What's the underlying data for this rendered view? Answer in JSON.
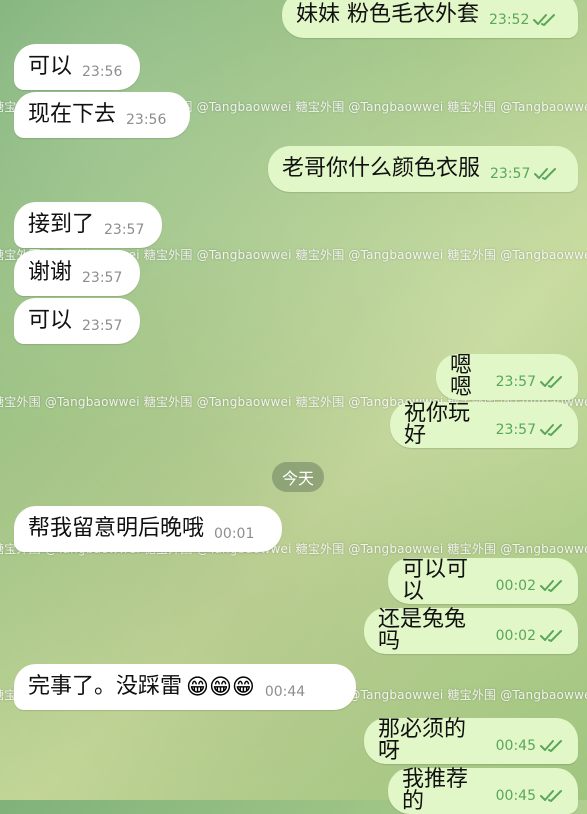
{
  "watermark": "糖宝外围 @Tangbaowwei  糖宝外围 @Tangbaowwei  糖宝外围 @Tangbaowwei  糖宝外围 @Tangbaowwei",
  "day_divider": "今天",
  "messages": [
    {
      "text": "妹妹 粉色毛衣外套",
      "time": "23:52",
      "side": "out",
      "read": true
    },
    {
      "text": "可以",
      "time": "23:56",
      "side": "in"
    },
    {
      "text": "现在下去",
      "time": "23:56",
      "side": "in"
    },
    {
      "text": "老哥你什么颜色衣服",
      "time": "23:57",
      "side": "out",
      "read": true
    },
    {
      "text": "接到了",
      "time": "23:57",
      "side": "in"
    },
    {
      "text": "谢谢",
      "time": "23:57",
      "side": "in"
    },
    {
      "text": "可以",
      "time": "23:57",
      "side": "in"
    },
    {
      "text": "嗯嗯",
      "time": "23:57",
      "side": "out",
      "read": true
    },
    {
      "text": "祝你玩好",
      "time": "23:57",
      "side": "out",
      "read": true
    },
    {
      "text": "帮我留意明后晚哦",
      "time": "00:01",
      "side": "in"
    },
    {
      "text": "可以可以",
      "time": "00:02",
      "side": "out",
      "read": true
    },
    {
      "text": "还是兔兔吗",
      "time": "00:02",
      "side": "out",
      "read": true
    },
    {
      "text": "完事了。没踩雷",
      "time": "00:44",
      "side": "in",
      "emoji": "😁😁😁"
    },
    {
      "text": "那必须的呀",
      "time": "00:45",
      "side": "out",
      "read": true
    },
    {
      "text": "我推荐的",
      "time": "00:45",
      "side": "out",
      "read": true
    }
  ],
  "colors": {
    "incoming_bg": "#ffffff",
    "outgoing_bg": "#e2f7c8",
    "check": "#5aa75a"
  }
}
